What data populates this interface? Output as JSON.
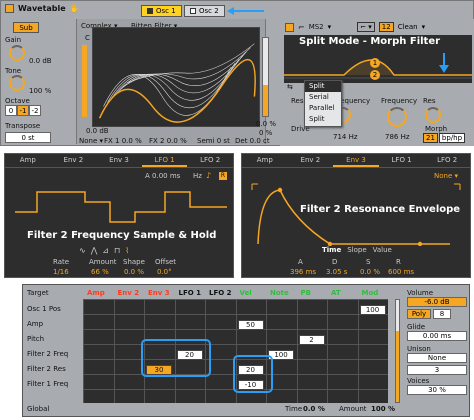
{
  "device": {
    "title": "Wavetable",
    "osc_tabs": [
      "Osc 1",
      "Osc 2"
    ]
  },
  "sub": {
    "sub_label": "Sub",
    "gain_label": "Gain",
    "gain_value": "0.0 dB",
    "tone_label": "Tone",
    "tone_value": "100 %",
    "octave_label": "Octave",
    "octave_values": [
      "0",
      "-1",
      "-2"
    ],
    "transpose_label": "Transpose",
    "transpose_value": "0 st"
  },
  "osc": {
    "category": "Complex",
    "wavetable": "Bitten Filter",
    "gain_value": "0.0 dB",
    "mode": "None",
    "fx1": "FX 1 0.0 %",
    "fx2": "FX 2 0.0 %",
    "semi": "Semi 0 st",
    "det": "Det 0.0 ct",
    "pos_value": "0.0 %",
    "pos_label": "0 %"
  },
  "filter": {
    "f1_type": "MS2",
    "f1_slope": "12",
    "f2_type": "Clean",
    "title": "Split Mode - Morph Filter",
    "marker1": "1",
    "marker2": "2",
    "routing_options": [
      "Split",
      "Serial",
      "Parallel",
      "Split"
    ],
    "res_label": "Res",
    "drive_label": "Drive",
    "frequency_label": "Frequency",
    "freq1_value": "714 Hz",
    "freq2_label": "Frequency",
    "freq2_value": "786 Hz",
    "res2_label": "Res",
    "morph_label": "Morph",
    "morph_value": "21",
    "morph_unit": "bp/hp"
  },
  "lfo": {
    "tabs": [
      "Amp",
      "Env 2",
      "Env 3",
      "LFO 1",
      "LFO 2"
    ],
    "active_tab": "LFO 1",
    "a_value": "A 0.00 ms",
    "hz": "Hz",
    "note_icon": "♪",
    "r_tag": "R",
    "title": "Filter 2 Frequency Sample & Hold",
    "controls": [
      {
        "label": "Rate",
        "value": "1/16"
      },
      {
        "label": "Amount",
        "value": "66 %"
      },
      {
        "label": "Shape",
        "value": "0.0 %"
      },
      {
        "label": "Offset",
        "value": "0.0°"
      }
    ]
  },
  "env": {
    "tabs": [
      "Amp",
      "Env 2",
      "Env 3",
      "LFO 1",
      "LFO 2"
    ],
    "active_tab": "Env 3",
    "none": "None",
    "title": "Filter 2 Resonance Envelope",
    "view_tabs": [
      "Time",
      "Slope",
      "Value"
    ],
    "controls": [
      {
        "label": "A",
        "value": "396 ms"
      },
      {
        "label": "D",
        "value": "3.05 s"
      },
      {
        "label": "S",
        "value": "0.0 %"
      },
      {
        "label": "R",
        "value": "600 ms"
      }
    ]
  },
  "matrix": {
    "target_label": "Target",
    "columns": [
      {
        "label": "Amp",
        "color": "#ff3b1f"
      },
      {
        "label": "Env 2",
        "color": "#ff3b1f"
      },
      {
        "label": "Env 3",
        "color": "#ff3b1f"
      },
      {
        "label": "LFO 1",
        "color": "#111111"
      },
      {
        "label": "LFO 2",
        "color": "#111111"
      },
      {
        "label": "Vel",
        "color": "#2fbf3a"
      },
      {
        "label": "Note",
        "color": "#2fbf3a"
      },
      {
        "label": "PB",
        "color": "#2fbf3a"
      },
      {
        "label": "AT",
        "color": "#2fbf3a"
      },
      {
        "label": "Mod",
        "color": "#2fbf3a"
      }
    ],
    "rows": [
      "Osc 1 Pos",
      "Amp",
      "Pitch",
      "Filter 2 Freq",
      "Filter 2 Res",
      "Filter 1 Freq"
    ],
    "values": {
      "amp_vel": "50",
      "pitch_pb": "2",
      "f2freq_lfo1": "20",
      "f2freq_note": "100",
      "f2res_env3": "30",
      "f2res_vel": "20",
      "f1freq_vel": "-10",
      "osc1pos_mod": "100"
    },
    "global_label": "Global",
    "time_label": "Time",
    "time_value": "0.0 %",
    "amount_label": "Amount",
    "amount_value": "100 %"
  },
  "side": {
    "volume_label": "Volume",
    "volume_value": "-6.0 dB",
    "poly_label": "Poly",
    "poly_voices": "8",
    "glide_label": "Glide",
    "glide_value": "0.00 ms",
    "unison_label": "Unison",
    "unison_value": "None",
    "unison_count": "3",
    "voices_label": "Voices",
    "amount_value": "30 %"
  },
  "colors": {
    "accent": "#f5a623",
    "highlight": "#2a9df4",
    "panel_dark": "#2d2d2d",
    "panel_grey": "#a8acb0"
  }
}
